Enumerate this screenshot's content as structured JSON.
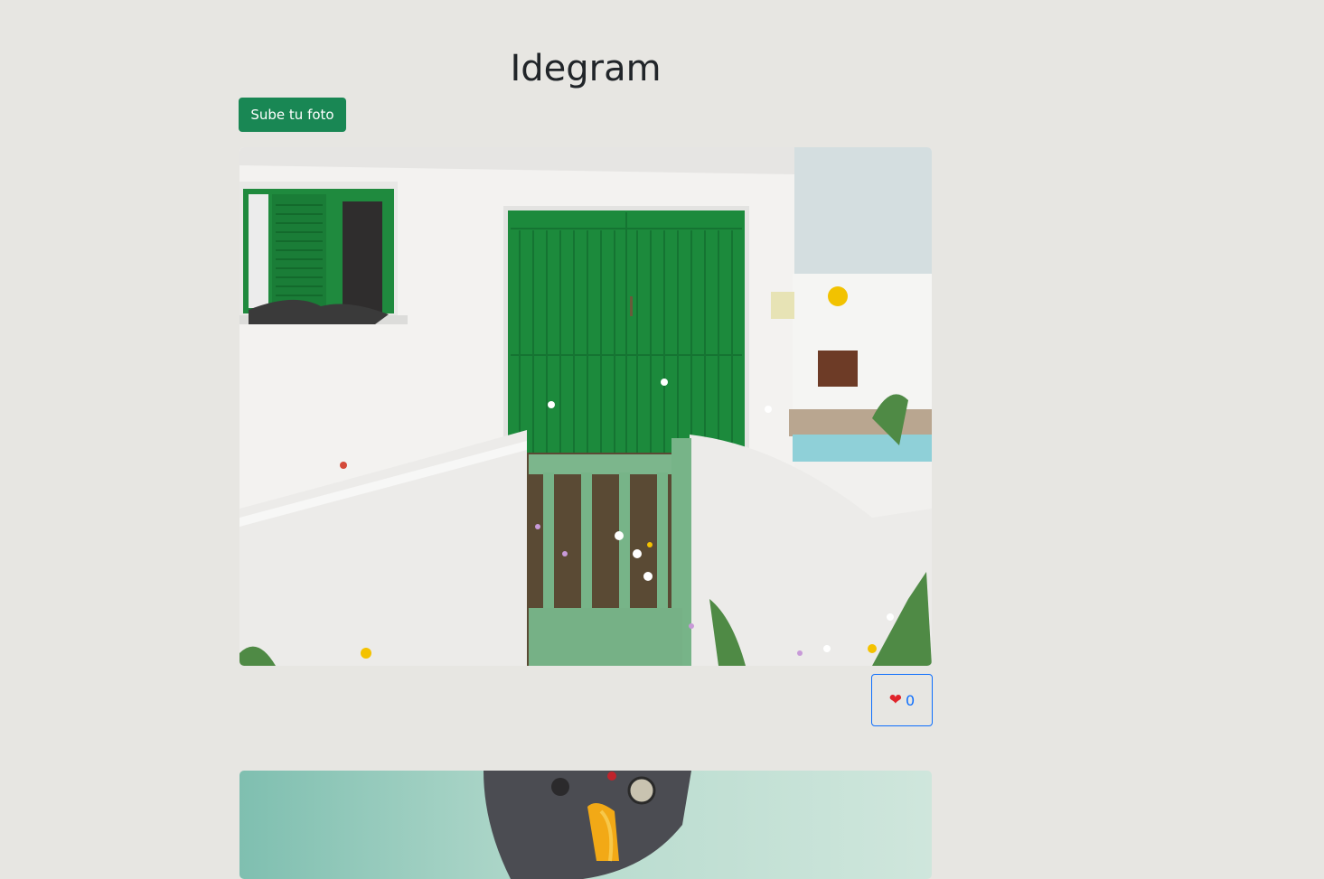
{
  "app": {
    "title": "Idegram"
  },
  "toolbar": {
    "upload_label": "Sube tu foto"
  },
  "posts": [
    {
      "image_desc_icon": "photo-white-house-green-door",
      "like_icon": "heart-icon",
      "like_glyph": "❤",
      "likes": "0"
    },
    {
      "image_desc_icon": "photo-bird-statue-sky"
    }
  ],
  "colors": {
    "background": "#e7e6e2",
    "primary_button": "#198754",
    "like_outline": "#0d6efd",
    "heart": "#e0242b"
  }
}
